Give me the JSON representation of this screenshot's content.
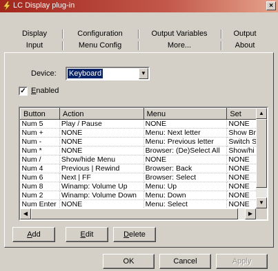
{
  "window": {
    "title": "LC Display plug-in",
    "close_label": "×"
  },
  "tabs_row1": [
    {
      "label": "Display"
    },
    {
      "label": "Configuration"
    },
    {
      "label": "Output Variables"
    },
    {
      "label": "Output"
    }
  ],
  "tabs_row2": [
    {
      "label": "Input"
    },
    {
      "label": "Menu Config"
    },
    {
      "label": "More..."
    },
    {
      "label": "About"
    }
  ],
  "input_tab": {
    "device_label": "Device:",
    "device_value": "Keyboard",
    "enabled_label": "Enabled",
    "enabled_checked": true,
    "list": {
      "columns": [
        "Button",
        "Action",
        "Menu",
        "Set"
      ],
      "rows": [
        [
          "Num 5",
          "Play / Pause",
          "NONE",
          "NONE"
        ],
        [
          "Num +",
          "NONE",
          "Menu: Next letter",
          "Show Br"
        ],
        [
          "Num -",
          "NONE",
          "Menu: Previous letter",
          "Switch S"
        ],
        [
          "Num *",
          "NONE",
          "Browser: (De)Select All",
          "Show/hi"
        ],
        [
          "Num /",
          "Show/hide Menu",
          "NONE",
          "NONE"
        ],
        [
          "Num 4",
          "Previous | Rewind",
          "Browser: Back",
          "NONE"
        ],
        [
          "Num 6",
          "Next | FF",
          "Browser: Select",
          "NONE"
        ],
        [
          "Num 8",
          "Winamp: Volume Up",
          "Menu: Up",
          "NONE"
        ],
        [
          "Num 2",
          "Winamp: Volume Down",
          "Menu: Down",
          "NONE"
        ],
        [
          "Num Enter",
          "NONE",
          "Menu: Select",
          "NONE"
        ]
      ]
    },
    "buttons": {
      "add": "Add",
      "edit": "Edit",
      "delete": "Delete"
    }
  },
  "footer": {
    "ok": "OK",
    "cancel": "Cancel",
    "apply": "Apply"
  },
  "colors": {
    "titlebar": "#a3261c",
    "face": "#d4d0c8",
    "selection": "#0a246a"
  }
}
